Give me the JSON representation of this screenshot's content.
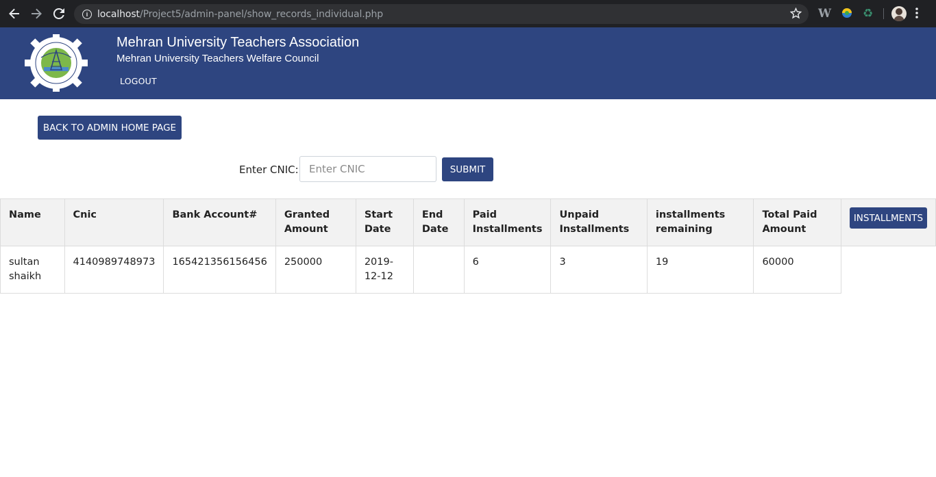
{
  "browser": {
    "url_host": "localhost",
    "url_path": "/Project5/admin-panel/show_records_individual.php"
  },
  "header": {
    "title": "Mehran University Teachers Association",
    "subtitle": "Mehran University Teachers Welfare Council",
    "logout_label": "LOGOUT",
    "bg_color": "#2e4580"
  },
  "actions": {
    "back_label": "BACK TO ADMIN HOME PAGE"
  },
  "search": {
    "label": "Enter CNIC:",
    "placeholder": "Enter CNIC",
    "value": "",
    "submit_label": "SUBMIT"
  },
  "table": {
    "headers": {
      "name": "Name",
      "cnic": "Cnic",
      "bank": "Bank Account#",
      "granted": "Granted Amount",
      "start": "Start Date",
      "end": "End Date",
      "paid": "Paid Installments",
      "unpaid": "Unpaid Installments",
      "remaining": "installments remaining",
      "total": "Total Paid Amount"
    },
    "installments_label": "INSTALLMENTS",
    "rows": [
      {
        "name": "sultan shaikh",
        "cnic": "4140989748973",
        "bank": "165421356156456",
        "granted": "250000",
        "start": "2019-12-12",
        "end": "",
        "paid": "6",
        "unpaid": "3",
        "remaining": "19",
        "total": "60000"
      }
    ]
  }
}
